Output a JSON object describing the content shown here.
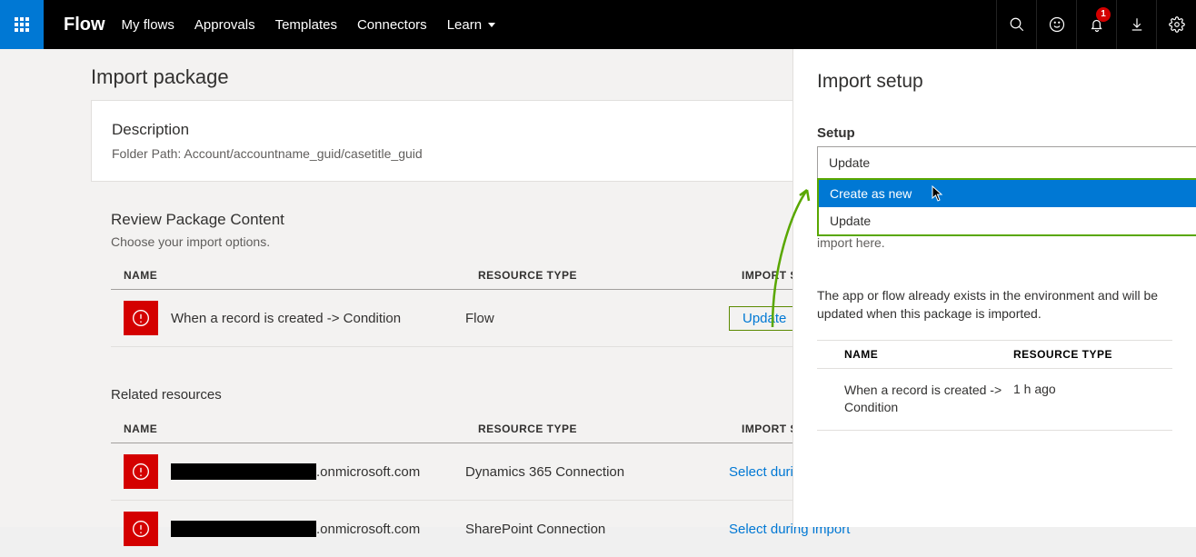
{
  "nav": {
    "brand": "Flow",
    "links": [
      "My flows",
      "Approvals",
      "Templates",
      "Connectors",
      "Learn"
    ],
    "notif_count": "1"
  },
  "page": {
    "title": "Import package",
    "desc_head": "Description",
    "desc_body": "Folder Path: Account/accountname_guid/casetitle_guid",
    "review_head": "Review Package Content",
    "review_sub": "Choose your import options.",
    "col_name": "NAME",
    "col_type": "RESOURCE TYPE",
    "col_setup": "IMPORT SETUP",
    "row1": {
      "name": "When a record is created -> Condition",
      "type": "Flow",
      "setup": "Update"
    },
    "related_head": "Related resources",
    "rel1": {
      "suffix": ".onmicrosoft.com",
      "type": "Dynamics 365 Connection",
      "setup": "Select during import"
    },
    "rel2": {
      "suffix": ".onmicrosoft.com",
      "type": "SharePoint Connection",
      "setup": "Select during import"
    }
  },
  "panel": {
    "title": "Import setup",
    "label": "Setup",
    "selected": "Update",
    "opt_new": "Create as new",
    "opt_upd": "Update",
    "frag": "import here.",
    "help": "The app or flow already exists in the environment and will be updated when this package is imported.",
    "col_name": "NAME",
    "col_type": "RESOURCE TYPE",
    "row_name": "When a record is created -> Condition",
    "row_time": "1 h ago"
  }
}
